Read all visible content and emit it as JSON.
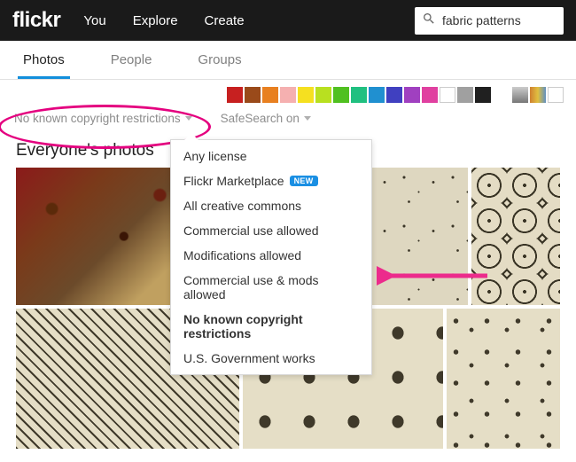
{
  "header": {
    "logo": "flickr",
    "nav": [
      "You",
      "Explore",
      "Create"
    ],
    "search_value": "fabric patterns"
  },
  "tabs": [
    {
      "label": "Photos",
      "active": true
    },
    {
      "label": "People",
      "active": false
    },
    {
      "label": "Groups",
      "active": false
    }
  ],
  "swatches": [
    "#c72020",
    "#9a4a1a",
    "#e88020",
    "#f5b0b0",
    "#f5e020",
    "#b8e020",
    "#50c020",
    "#20c080",
    "#2090d0",
    "#4040c0",
    "#a040c0",
    "#e040a0",
    "#ffffff",
    "#a0a0a0",
    "#202020"
  ],
  "filters": {
    "license_label": "No known copyright restrictions",
    "safesearch_label": "SafeSearch on"
  },
  "dropdown": {
    "items": [
      {
        "label": "Any license",
        "bold": false,
        "badge": null
      },
      {
        "label": "Flickr Marketplace",
        "bold": false,
        "badge": "NEW"
      },
      {
        "label": "All creative commons",
        "bold": false,
        "badge": null
      },
      {
        "label": "Commercial use allowed",
        "bold": false,
        "badge": null
      },
      {
        "label": "Modifications allowed",
        "bold": false,
        "badge": null
      },
      {
        "label": "Commercial use & mods allowed",
        "bold": false,
        "badge": null
      },
      {
        "label": "No known copyright restrictions",
        "bold": true,
        "badge": null
      },
      {
        "label": "U.S. Government works",
        "bold": false,
        "badge": null
      }
    ]
  },
  "section": {
    "title": "Everyone's photos"
  }
}
